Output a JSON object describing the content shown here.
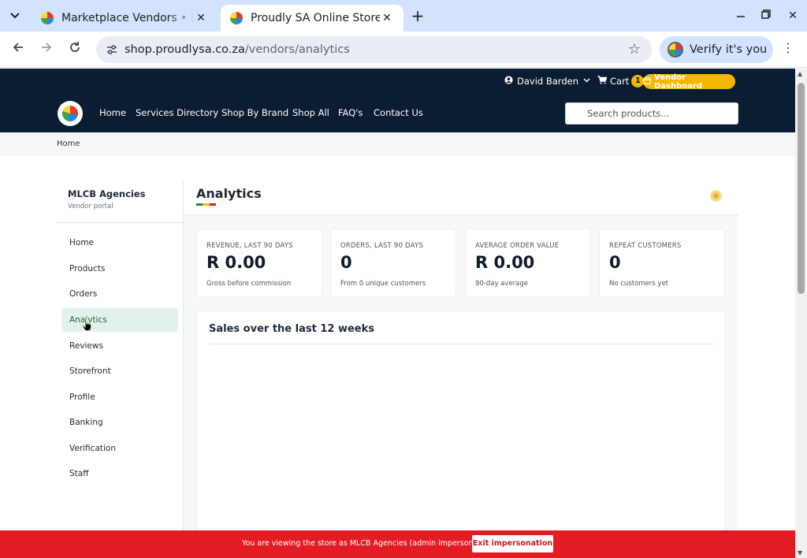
{
  "browser": {
    "tabs": [
      {
        "title": "Marketplace Vendors • Proudly SA",
        "active": false
      },
      {
        "title": "Proudly SA Online Store",
        "active": true
      }
    ],
    "url_host": "shop.proudlysa.co.za",
    "url_path": "/vendors/analytics",
    "verify_label": "Verify it's you",
    "icons": {
      "tab_menu": "chevron-down-icon",
      "close": "close-icon",
      "new_tab": "plus-icon",
      "back": "arrow-left-icon",
      "forward": "arrow-right-icon",
      "reload": "reload-icon",
      "site_info": "tune-icon",
      "bookmark": "star-icon",
      "menu": "kebab-icon"
    }
  },
  "topbar": {
    "user_name": "David Barden",
    "cart_label": "Cart",
    "cart_count": "1",
    "vendor_dashboard_label": "Vendor Dashboard"
  },
  "nav": {
    "links": [
      "Home",
      "Services Directory",
      "Shop By Brand",
      "Shop All",
      "FAQ's",
      "Contact Us"
    ],
    "search_placeholder": "Search products..."
  },
  "breadcrumb": [
    "Home"
  ],
  "sidebar": {
    "vendor_name": "MLCB Agencies",
    "vendor_subtitle": "Vendor portal",
    "items": [
      {
        "label": "Home",
        "active": false
      },
      {
        "label": "Products",
        "active": false
      },
      {
        "label": "Orders",
        "active": false
      },
      {
        "label": "Analytics",
        "active": true
      },
      {
        "label": "Reviews",
        "active": false
      },
      {
        "label": "Storefront",
        "active": false
      },
      {
        "label": "Profile",
        "active": false
      },
      {
        "label": "Banking",
        "active": false
      },
      {
        "label": "Verification",
        "active": false
      },
      {
        "label": "Staff",
        "active": false
      }
    ]
  },
  "page": {
    "title": "Analytics",
    "stats": [
      {
        "label": "REVENUE, LAST 90 DAYS",
        "value": "R 0.00",
        "note": "Gross before commission"
      },
      {
        "label": "ORDERS, LAST 90 DAYS",
        "value": "0",
        "note": "From 0 unique customers"
      },
      {
        "label": "AVERAGE ORDER VALUE",
        "value": "R 0.00",
        "note": "90-day average"
      },
      {
        "label": "REPEAT CUSTOMERS",
        "value": "0",
        "note": "No customers yet"
      }
    ],
    "sales_title": "Sales over the last 12 weeks"
  },
  "impersonation": {
    "message": "You are viewing the store as MLCB Agencies (admin impersonation)",
    "exit_label": "Exit impersonation"
  },
  "colors": {
    "brand_navy": "#0b1d33",
    "accent_yellow": "#f5b800",
    "active_green_bg": "#e3f2e8",
    "active_green_text": "#1b6b38",
    "danger_red": "#e31b23",
    "title_underline": [
      "#1b8a3c",
      "#f5b800",
      "#e31b23"
    ]
  }
}
